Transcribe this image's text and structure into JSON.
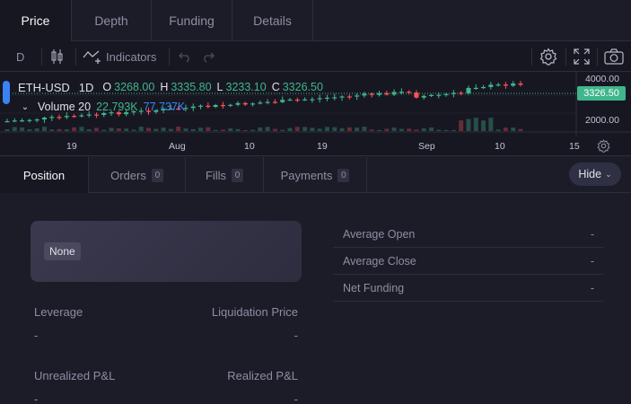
{
  "top_tabs": [
    {
      "label": "Price",
      "active": true
    },
    {
      "label": "Depth",
      "active": false
    },
    {
      "label": "Funding",
      "active": false
    },
    {
      "label": "Details",
      "active": false
    }
  ],
  "toolbar": {
    "resolution": "D",
    "indicators_label": "Indicators"
  },
  "chart": {
    "symbol": "ETH-USD",
    "interval": "1D",
    "open_key": "O",
    "open": "3268.00",
    "high_key": "H",
    "high": "3335.80",
    "low_key": "L",
    "low": "3233.10",
    "close_key": "C",
    "close": "3326.50",
    "volume_label": "Volume 20",
    "volume_value": "22.793K",
    "volume_ma": "77.737K",
    "last_price": "3326.50",
    "y_ticks": [
      "4000.00",
      "2000.00"
    ],
    "x_ticks": [
      "19",
      "Aug",
      "10",
      "19",
      "Sep",
      "10",
      "15"
    ],
    "colors": {
      "up": "#3fb68b",
      "down": "#ff5353",
      "ma": "#3b82f6"
    }
  },
  "bottom_tabs": [
    {
      "label": "Position",
      "count": null,
      "active": true
    },
    {
      "label": "Orders",
      "count": "0",
      "active": false
    },
    {
      "label": "Fills",
      "count": "0",
      "active": false
    },
    {
      "label": "Payments",
      "count": "0",
      "active": false
    }
  ],
  "hide_label": "Hide",
  "position": {
    "market_badge": "None",
    "leverage_label": "Leverage",
    "leverage_value": "-",
    "liquidation_label": "Liquidation Price",
    "liquidation_value": "-",
    "unrealized_label": "Unrealized P&L",
    "unrealized_value": "-",
    "realized_label": "Realized P&L",
    "realized_value": "-"
  },
  "stats": [
    {
      "label": "Average Open",
      "value": "-"
    },
    {
      "label": "Average Close",
      "value": "-"
    },
    {
      "label": "Net Funding",
      "value": "-"
    }
  ]
}
